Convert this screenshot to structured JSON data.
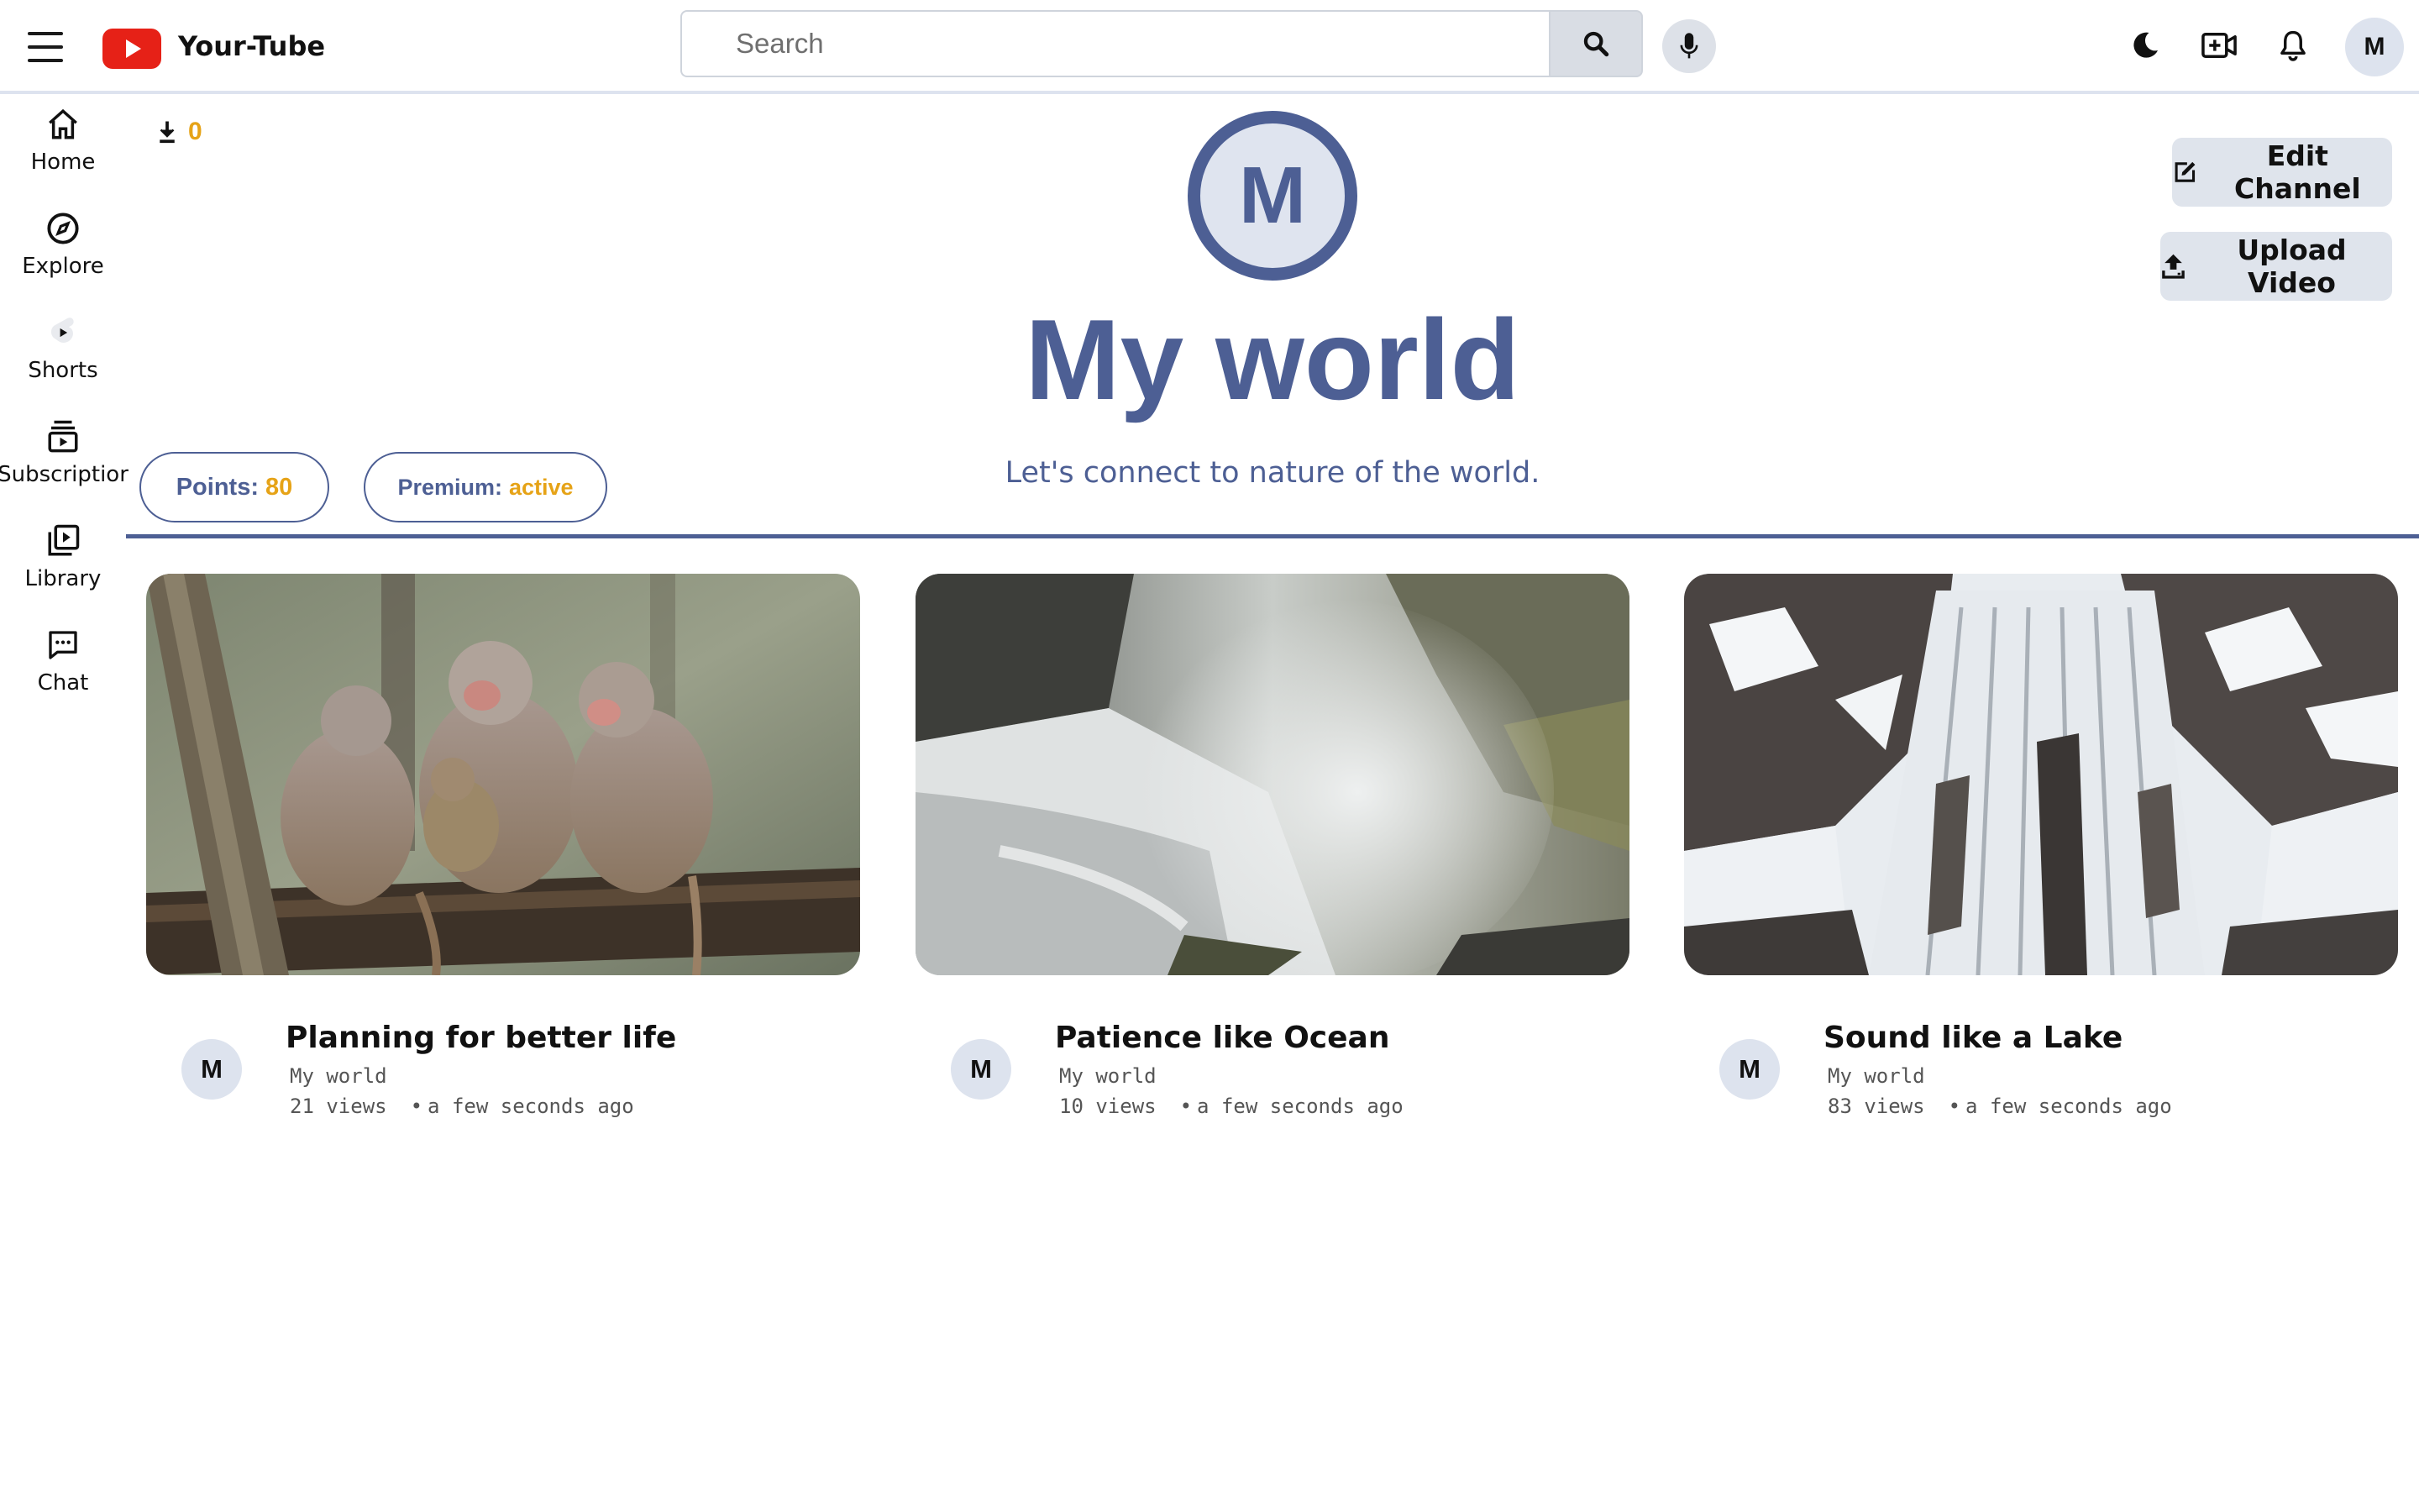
{
  "header": {
    "app_title": "Your-Tube",
    "search_placeholder": "Search",
    "avatar_letter": "M",
    "icons": [
      "menu-icon",
      "youtube-logo",
      "search-icon",
      "microphone-icon",
      "moon-icon",
      "video-add-icon",
      "bell-icon"
    ]
  },
  "sidebar": {
    "items": [
      {
        "label": "Home",
        "icon": "home-icon"
      },
      {
        "label": "Explore",
        "icon": "compass-icon"
      },
      {
        "label": "Shorts",
        "icon": "shorts-icon"
      },
      {
        "label": "Subscriptior",
        "icon": "subscriptions-icon"
      },
      {
        "label": "Library",
        "icon": "library-icon"
      },
      {
        "label": "Chat",
        "icon": "chat-icon"
      }
    ]
  },
  "channel": {
    "download_count": "0",
    "avatar_letter": "M",
    "name": "My world",
    "description": "Let's connect to nature of the world.",
    "edit_label": "Edit Channel",
    "upload_label": "Upload Video",
    "points_label": "Points:",
    "points_value": "80",
    "premium_label": "Premium:",
    "premium_value": "active"
  },
  "colors": {
    "accent": "#4d5f94",
    "highlight": "#e6a317",
    "button_bg": "#dfe4ec"
  },
  "videos": [
    {
      "title": "Planning for better life",
      "channel": "My world",
      "views": "21 views",
      "time": "a few seconds ago",
      "avatar": "M",
      "thumbnail": "baboons-on-log"
    },
    {
      "title": "Patience like Ocean",
      "channel": "My world",
      "views": "10 views",
      "time": "a few seconds ago",
      "avatar": "M",
      "thumbnail": "misty-waterfall"
    },
    {
      "title": "Sound like a Lake",
      "channel": "My world",
      "views": "83 views",
      "time": "a few seconds ago",
      "avatar": "M",
      "thumbnail": "snowy-waterfall"
    }
  ]
}
